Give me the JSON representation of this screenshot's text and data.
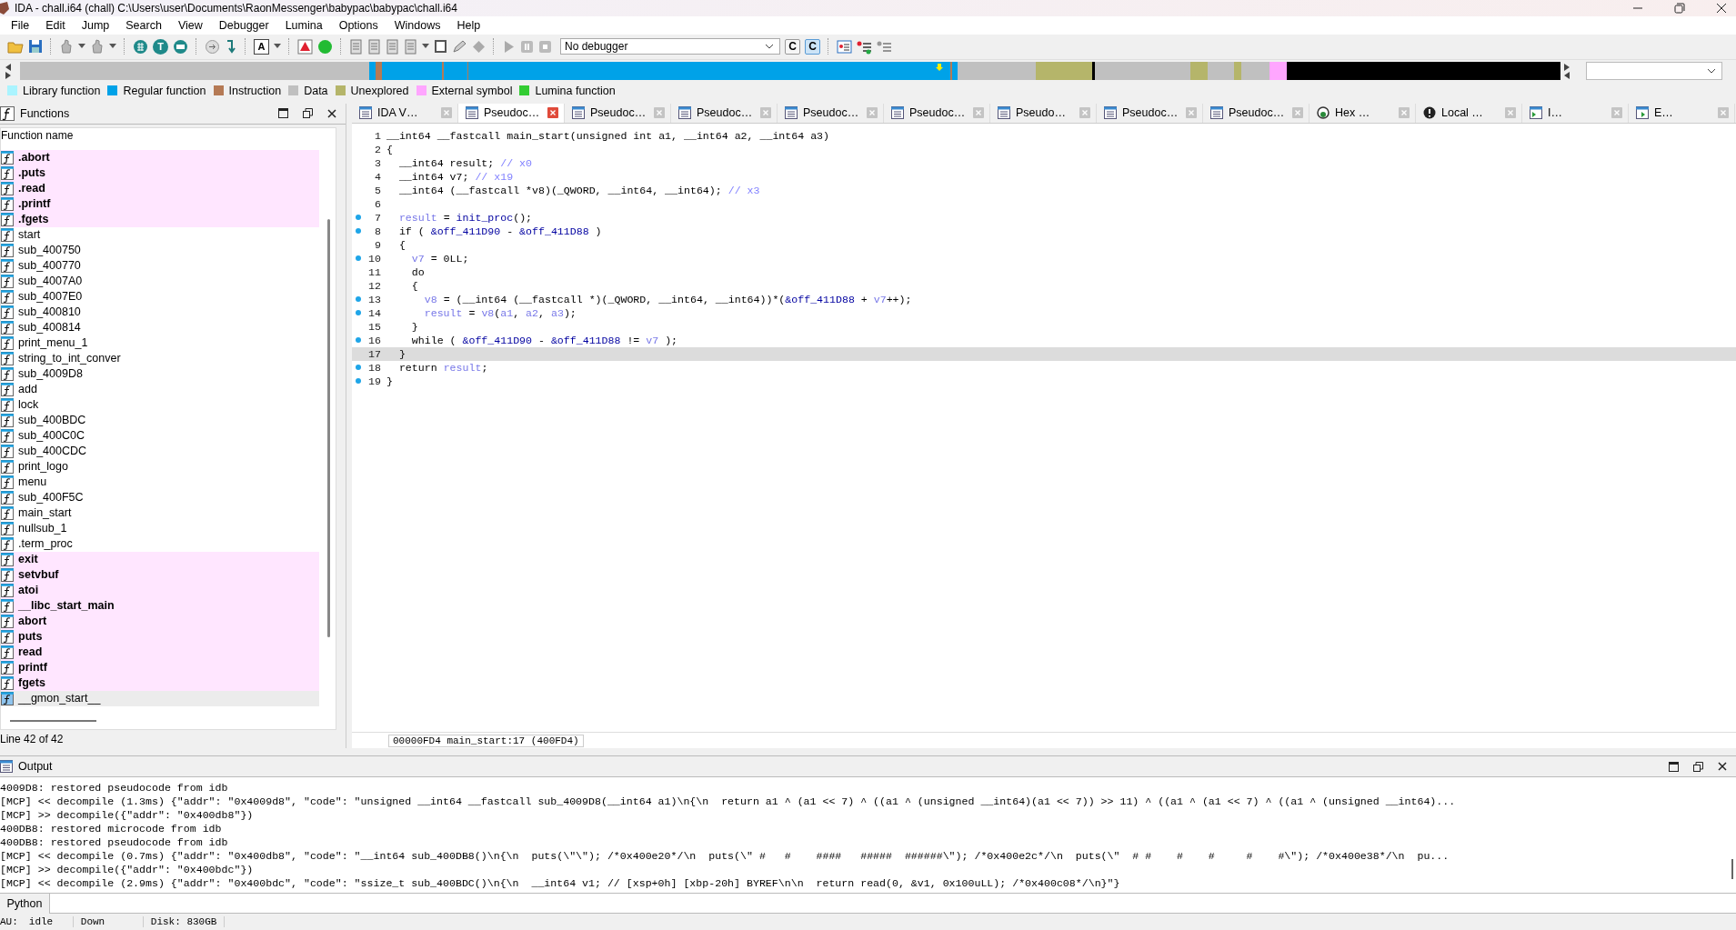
{
  "window": {
    "title": "IDA - chall.i64 (chall) C:\\Users\\user\\Documents\\RaonMessenger\\babypac\\babypac\\chall.i64"
  },
  "menu": [
    "File",
    "Edit",
    "Jump",
    "Search",
    "View",
    "Debugger",
    "Lumina",
    "Options",
    "Windows",
    "Help"
  ],
  "toolbar": {
    "letter_buttons": [
      {
        "label": "T",
        "selected": false
      },
      {
        "label": "A",
        "selected": false
      },
      {
        "label": "C",
        "selected": false
      },
      {
        "label": "C",
        "selected": true
      }
    ],
    "debugger": "No debugger"
  },
  "legend": [
    {
      "label": "Library function",
      "color": "#aaf4ff"
    },
    {
      "label": "Regular function",
      "color": "#00a2e8"
    },
    {
      "label": "Instruction",
      "color": "#b57a55"
    },
    {
      "label": "Data",
      "color": "#c0c0c0"
    },
    {
      "label": "Unexplored",
      "color": "#b5b56a"
    },
    {
      "label": "External symbol",
      "color": "#ffa6ff"
    },
    {
      "label": "Lumina function",
      "color": "#33cc33"
    }
  ],
  "functions": {
    "title": "Functions",
    "column": "Function name",
    "status": "Line 42 of 42",
    "items": [
      {
        "name": ".abort",
        "kind": "import",
        "selected": false
      },
      {
        "name": ".puts",
        "kind": "import",
        "selected": false
      },
      {
        "name": ".read",
        "kind": "import",
        "selected": false
      },
      {
        "name": ".printf",
        "kind": "import",
        "selected": false
      },
      {
        "name": ".fgets",
        "kind": "import",
        "selected": false
      },
      {
        "name": "start",
        "kind": "local",
        "selected": false
      },
      {
        "name": "sub_400750",
        "kind": "local",
        "selected": false
      },
      {
        "name": "sub_400770",
        "kind": "local",
        "selected": false
      },
      {
        "name": "sub_4007A0",
        "kind": "local",
        "selected": false
      },
      {
        "name": "sub_4007E0",
        "kind": "local",
        "selected": false
      },
      {
        "name": "sub_400810",
        "kind": "local",
        "selected": false
      },
      {
        "name": "sub_400814",
        "kind": "local",
        "selected": false
      },
      {
        "name": "print_menu_1",
        "kind": "local",
        "selected": false
      },
      {
        "name": "string_to_int_conver",
        "kind": "local",
        "selected": false
      },
      {
        "name": "sub_4009D8",
        "kind": "local",
        "selected": false
      },
      {
        "name": "add",
        "kind": "local",
        "selected": false
      },
      {
        "name": "lock",
        "kind": "local",
        "selected": false
      },
      {
        "name": "sub_400BDC",
        "kind": "local",
        "selected": false
      },
      {
        "name": "sub_400C0C",
        "kind": "local",
        "selected": false
      },
      {
        "name": "sub_400CDC",
        "kind": "local",
        "selected": false
      },
      {
        "name": "print_logo",
        "kind": "local",
        "selected": false
      },
      {
        "name": "menu",
        "kind": "local",
        "selected": false
      },
      {
        "name": "sub_400F5C",
        "kind": "local",
        "selected": false
      },
      {
        "name": "main_start",
        "kind": "local",
        "selected": false
      },
      {
        "name": "nullsub_1",
        "kind": "local",
        "selected": false
      },
      {
        "name": ".term_proc",
        "kind": "local",
        "selected": false
      },
      {
        "name": "exit",
        "kind": "import",
        "selected": false
      },
      {
        "name": "setvbuf",
        "kind": "import",
        "selected": false
      },
      {
        "name": "atoi",
        "kind": "import",
        "selected": false
      },
      {
        "name": "__libc_start_main",
        "kind": "import",
        "selected": false
      },
      {
        "name": "abort",
        "kind": "import",
        "selected": false
      },
      {
        "name": "puts",
        "kind": "import",
        "selected": false
      },
      {
        "name": "read",
        "kind": "import",
        "selected": false
      },
      {
        "name": "printf",
        "kind": "import",
        "selected": false
      },
      {
        "name": "fgets",
        "kind": "import",
        "selected": false
      },
      {
        "name": "__gmon_start__",
        "kind": "local",
        "selected": true
      }
    ]
  },
  "tabs": [
    {
      "label": "IDA V…",
      "kind": "doc",
      "selected": false
    },
    {
      "label": "Pseudoc…",
      "kind": "doc",
      "selected": true
    },
    {
      "label": "Pseudoc…",
      "kind": "doc",
      "selected": false
    },
    {
      "label": "Pseudoc…",
      "kind": "doc",
      "selected": false
    },
    {
      "label": "Pseudoc…",
      "kind": "doc",
      "selected": false
    },
    {
      "label": "Pseudoc…",
      "kind": "doc",
      "selected": false
    },
    {
      "label": "Pseudo…",
      "kind": "doc",
      "selected": false
    },
    {
      "label": "Pseudoc…",
      "kind": "doc",
      "selected": false
    },
    {
      "label": "Pseudoc…",
      "kind": "doc",
      "selected": false
    },
    {
      "label": "Hex …",
      "kind": "hex",
      "selected": false
    },
    {
      "label": "Local …",
      "kind": "local",
      "selected": false
    },
    {
      "label": "I…",
      "kind": "import",
      "selected": false
    },
    {
      "label": "E…",
      "kind": "export",
      "selected": false
    }
  ],
  "code": {
    "status": "00000FD4 main_start:17 (400FD4)",
    "lines": [
      {
        "no": "1",
        "marked": false,
        "selected": false,
        "parts": [
          {
            "kind": "code",
            "text": "__int64 __fastcall main_start(unsigned int a1, __int64 a2, __int64 a3)"
          }
        ]
      },
      {
        "no": "2",
        "marked": false,
        "selected": false,
        "parts": [
          {
            "kind": "code",
            "text": "{"
          }
        ]
      },
      {
        "no": "3",
        "marked": false,
        "selected": false,
        "parts": [
          {
            "kind": "code",
            "text": "  __int64 result; "
          },
          {
            "kind": "comment",
            "text": "// x0"
          }
        ]
      },
      {
        "no": "4",
        "marked": false,
        "selected": false,
        "parts": [
          {
            "kind": "code",
            "text": "  __int64 v7; "
          },
          {
            "kind": "comment",
            "text": "// x19"
          }
        ]
      },
      {
        "no": "5",
        "marked": false,
        "selected": false,
        "parts": [
          {
            "kind": "code",
            "text": "  __int64 (__fastcall *v8)(_QWORD, __int64, __int64); "
          },
          {
            "kind": "comment",
            "text": "// x3"
          }
        ]
      },
      {
        "no": "6",
        "marked": false,
        "selected": false
      },
      {
        "no": "7",
        "marked": true,
        "selected": false,
        "parts": [
          {
            "kind": "var",
            "text": "  result"
          },
          {
            "kind": "code",
            "text": " = "
          },
          {
            "kind": "name",
            "text": "init_proc"
          },
          {
            "kind": "code",
            "text": "();"
          }
        ]
      },
      {
        "no": "8",
        "marked": true,
        "selected": false,
        "parts": [
          {
            "kind": "code",
            "text": "  if ( "
          },
          {
            "kind": "name",
            "text": "&off_411D90"
          },
          {
            "kind": "code",
            "text": " - "
          },
          {
            "kind": "name",
            "text": "&off_411D88"
          },
          {
            "kind": "code",
            "text": " )"
          }
        ]
      },
      {
        "no": "9",
        "marked": false,
        "selected": false,
        "parts": [
          {
            "kind": "code",
            "text": "  {"
          }
        ]
      },
      {
        "no": "10",
        "marked": true,
        "selected": false,
        "parts": [
          {
            "kind": "var",
            "text": "    v7"
          },
          {
            "kind": "code",
            "text": " = 0LL;"
          }
        ]
      },
      {
        "no": "11",
        "marked": false,
        "selected": false,
        "parts": [
          {
            "kind": "code",
            "text": "    do"
          }
        ]
      },
      {
        "no": "12",
        "marked": false,
        "selected": false,
        "parts": [
          {
            "kind": "code",
            "text": "    {"
          }
        ]
      },
      {
        "no": "13",
        "marked": true,
        "selected": false,
        "parts": [
          {
            "kind": "var",
            "text": "      v8"
          },
          {
            "kind": "code",
            "text": " = (__int64 (__fastcall *)(_QWORD, __int64, __int64))*("
          },
          {
            "kind": "name",
            "text": "&off_411D88"
          },
          {
            "kind": "code",
            "text": " + "
          },
          {
            "kind": "var",
            "text": "v7"
          },
          {
            "kind": "code",
            "text": "++);"
          }
        ]
      },
      {
        "no": "14",
        "marked": true,
        "selected": false,
        "parts": [
          {
            "kind": "var",
            "text": "      result"
          },
          {
            "kind": "code",
            "text": " = "
          },
          {
            "kind": "var",
            "text": "v8"
          },
          {
            "kind": "code",
            "text": "("
          },
          {
            "kind": "var",
            "text": "a1"
          },
          {
            "kind": "code",
            "text": ", "
          },
          {
            "kind": "var",
            "text": "a2"
          },
          {
            "kind": "code",
            "text": ", "
          },
          {
            "kind": "var",
            "text": "a3"
          },
          {
            "kind": "code",
            "text": ");"
          }
        ]
      },
      {
        "no": "15",
        "marked": false,
        "selected": false,
        "parts": [
          {
            "kind": "code",
            "text": "    }"
          }
        ]
      },
      {
        "no": "16",
        "marked": true,
        "selected": false,
        "parts": [
          {
            "kind": "code",
            "text": "    while ( "
          },
          {
            "kind": "name",
            "text": "&off_411D90"
          },
          {
            "kind": "code",
            "text": " - "
          },
          {
            "kind": "name",
            "text": "&off_411D88"
          },
          {
            "kind": "code",
            "text": " != "
          },
          {
            "kind": "var",
            "text": "v7"
          },
          {
            "kind": "code",
            "text": " );"
          }
        ]
      },
      {
        "no": "17",
        "marked": false,
        "selected": true,
        "parts": [
          {
            "kind": "code",
            "text": "  }"
          }
        ]
      },
      {
        "no": "18",
        "marked": true,
        "selected": false,
        "parts": [
          {
            "kind": "code",
            "text": "  return "
          },
          {
            "kind": "var",
            "text": "result"
          },
          {
            "kind": "code",
            "text": ";"
          }
        ]
      },
      {
        "no": "19",
        "marked": true,
        "selected": false,
        "parts": [
          {
            "kind": "code",
            "text": "}"
          }
        ]
      }
    ]
  },
  "output": {
    "title": "Output",
    "lines": [
      "4009D8: restored pseudocode from idb",
      "[MCP] << decompile (1.3ms) {\"addr\": \"0x4009d8\", \"code\": \"unsigned __int64 __fastcall sub_4009D8(__int64 a1)\\n{\\n  return a1 ^ (a1 << 7) ^ ((a1 ^ (unsigned __int64)(a1 << 7)) >> 11) ^ ((a1 ^ (a1 << 7) ^ ((a1 ^ (unsigned __int64)...",
      "[MCP] >> decompile({\"addr\": \"0x400db8\"})",
      "400DB8: restored microcode from idb",
      "400DB8: restored pseudocode from idb",
      "[MCP] << decompile (0.7ms) {\"addr\": \"0x400db8\", \"code\": \"__int64 sub_400DB8()\\n{\\n  puts(\\\"\\\"); /*0x400e20*/\\n  puts(\\\" #   #    ####   #####  ######\\\"); /*0x400e2c*/\\n  puts(\\\"  # #    #    #     #    #\\\"); /*0x400e38*/\\n  pu...",
      "[MCP] >> decompile({\"addr\": \"0x400bdc\"})",
      "[MCP] << decompile (2.9ms) {\"addr\": \"0x400bdc\", \"code\": \"ssize_t sub_400BDC()\\n{\\n  __int64 v1; // [xsp+0h] [xbp-20h] BYREF\\n\\n  return read(0, &v1, 0x100uLL); /*0x400c08*/\\n}\"}"
    ],
    "input_label": "Python"
  },
  "status_bar": [
    "AU:",
    "idle",
    "Down",
    "Disk: 830GB"
  ]
}
